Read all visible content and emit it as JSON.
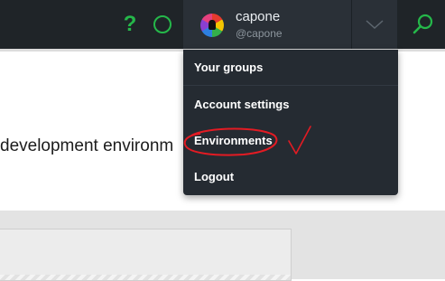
{
  "header": {
    "user": {
      "name": "capone",
      "handle": "@capone"
    },
    "icons": [
      "help-icon",
      "status-circle-icon",
      "chevron-down-icon",
      "search-icon"
    ],
    "accent_color": "#25b84a"
  },
  "dropdown": {
    "items": [
      {
        "label": "Your groups"
      },
      {
        "label": "Account settings"
      },
      {
        "label": "Environments"
      },
      {
        "label": "Logout"
      }
    ]
  },
  "page": {
    "text": "development environm"
  },
  "annotation": {
    "color": "#e31b23"
  }
}
